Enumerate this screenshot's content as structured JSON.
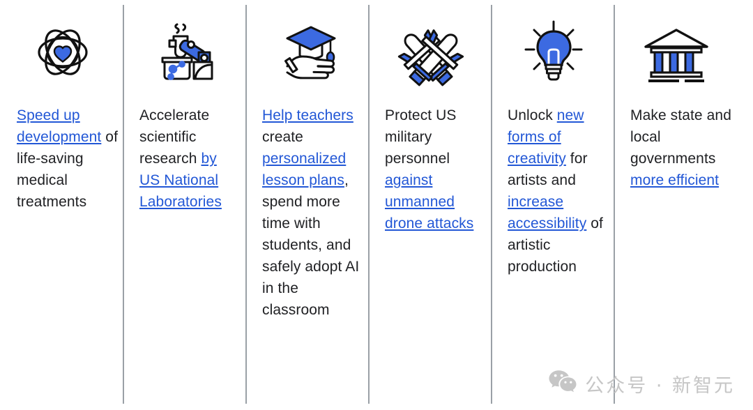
{
  "theme": {
    "background": "#ffffff",
    "text_color": "#202124",
    "link_color": "#2257d6",
    "divider_color": "#9aa0a6",
    "icon_accent": "#3c6ae1",
    "icon_outline": "#111111",
    "watermark_color": "#c6c6c6"
  },
  "columns": [
    {
      "icon_name": "atom-heart-icon",
      "segments": [
        {
          "text": "Speed up development",
          "link": true
        },
        {
          "text": " of life-saving medical treatments",
          "link": false
        }
      ]
    },
    {
      "icon_name": "robot-arm-lab-icon",
      "segments": [
        {
          "text": "Accelerate scientific research ",
          "link": false
        },
        {
          "text": "by US National Laboratories",
          "link": true
        }
      ]
    },
    {
      "icon_name": "hand-graduation-cap-icon",
      "segments": [
        {
          "text": "Help teachers",
          "link": true
        },
        {
          "text": " create ",
          "link": false
        },
        {
          "text": "personalized lesson plans",
          "link": true
        },
        {
          "text": ", spend more time with students, and safely adopt AI in the classroom",
          "link": false
        }
      ]
    },
    {
      "icon_name": "crossed-drones-icon",
      "segments": [
        {
          "text": "Protect US military personnel ",
          "link": false
        },
        {
          "text": "against unmanned drone attacks",
          "link": true
        }
      ]
    },
    {
      "icon_name": "lightbulb-idea-icon",
      "segments": [
        {
          "text": "Unlock ",
          "link": false
        },
        {
          "text": "new forms of creativity",
          "link": true
        },
        {
          "text": " for artists and ",
          "link": false
        },
        {
          "text": "increase accessibility",
          "link": true
        },
        {
          "text": " of artistic production",
          "link": false
        }
      ]
    },
    {
      "icon_name": "government-building-icon",
      "segments": [
        {
          "text": "Make state and local governments ",
          "link": false
        },
        {
          "text": "more efficient",
          "link": true
        }
      ]
    }
  ],
  "watermark": {
    "icon_name": "wechat-icon",
    "label": "公众号 · 新智元"
  }
}
